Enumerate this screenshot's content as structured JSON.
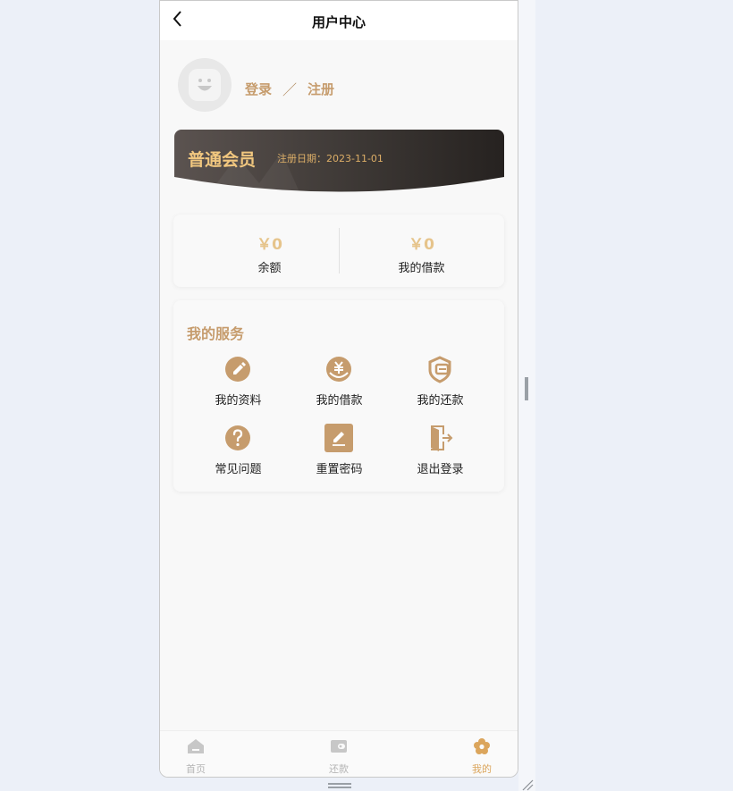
{
  "header": {
    "title": "用户中心"
  },
  "auth": {
    "login": "登录",
    "separator": "／",
    "register": "注册"
  },
  "member": {
    "level": "普通会员",
    "register_date": "注册日期：2023-11-01"
  },
  "balance": {
    "items": [
      {
        "amount": "￥0",
        "label": "余额"
      },
      {
        "amount": "￥0",
        "label": "我的借款"
      }
    ]
  },
  "services": {
    "title": "我的服务",
    "items": [
      {
        "label": "我的资料",
        "icon": "edit-profile-icon"
      },
      {
        "label": "我的借款",
        "icon": "yuan-loan-icon"
      },
      {
        "label": "我的还款",
        "icon": "wallet-shield-icon"
      },
      {
        "label": "常见问题",
        "icon": "question-icon"
      },
      {
        "label": "重置密码",
        "icon": "pencil-square-icon"
      },
      {
        "label": "退出登录",
        "icon": "exit-door-icon"
      }
    ]
  },
  "tabbar": {
    "items": [
      {
        "label": "首页",
        "icon": "home-icon",
        "active": false
      },
      {
        "label": "还款",
        "icon": "wallet-icon",
        "active": false
      },
      {
        "label": "我的",
        "icon": "flower-profile-icon",
        "active": true
      }
    ]
  },
  "colors": {
    "accent": "#c69c6d",
    "gold": "#e6c48b",
    "tab_active": "#dba55c",
    "card_dark": "#2e2a27"
  }
}
